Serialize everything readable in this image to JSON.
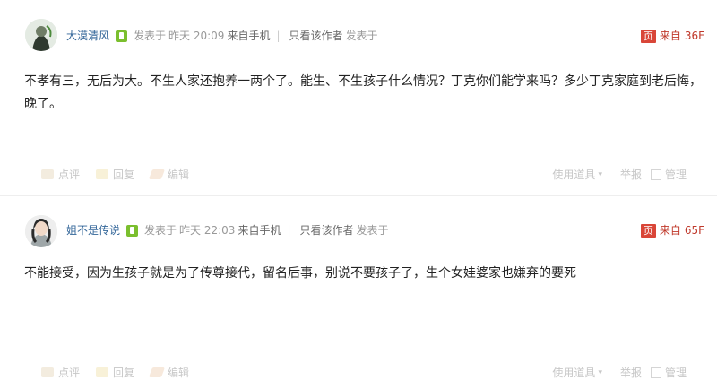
{
  "posts": [
    {
      "username": "大漠清风",
      "posted_label": "发表于",
      "time": "昨天 20:09",
      "source": "来自手机",
      "separator": "|",
      "only_author": "只看该作者",
      "posted_label_2": "发表于",
      "floor_icon_text": "页",
      "floor_from": "来自",
      "floor_number": "36F",
      "content": "不孝有三，无后为大。不生人家还抱养一两个了。能生、不生孩子什么情况？丁克你们能学来吗？多少丁克家庭到老后悔，晚了。",
      "actions": {
        "comment": "点评",
        "reply": "回复",
        "edit": "编辑"
      },
      "tools": {
        "use_tools": "使用道具",
        "report": "举报",
        "manage": "管理"
      }
    },
    {
      "username": "姐不是传说",
      "posted_label": "发表于",
      "time": "昨天 22:03",
      "source": "来自手机",
      "separator": "|",
      "only_author": "只看该作者",
      "posted_label_2": "发表于",
      "floor_icon_text": "页",
      "floor_from": "来自",
      "floor_number": "65F",
      "content": "不能接受，因为生孩子就是为了传尊接代，留名后事，别说不要孩子了，生个女娃婆家也嫌弃的要死",
      "actions": {
        "comment": "点评",
        "reply": "回复",
        "edit": "编辑"
      },
      "tools": {
        "use_tools": "使用道具",
        "report": "举报",
        "manage": "管理"
      }
    }
  ],
  "colors": {
    "username": "#336699",
    "floor": "#c0392b",
    "level_badge": "#7bbf2e",
    "floor_icon": "#d94638"
  },
  "icons": {
    "level": "user-level-icon",
    "floor": "floor-source-icon",
    "comment": "comment-icon",
    "reply": "reply-icon",
    "edit": "pencil-icon"
  }
}
